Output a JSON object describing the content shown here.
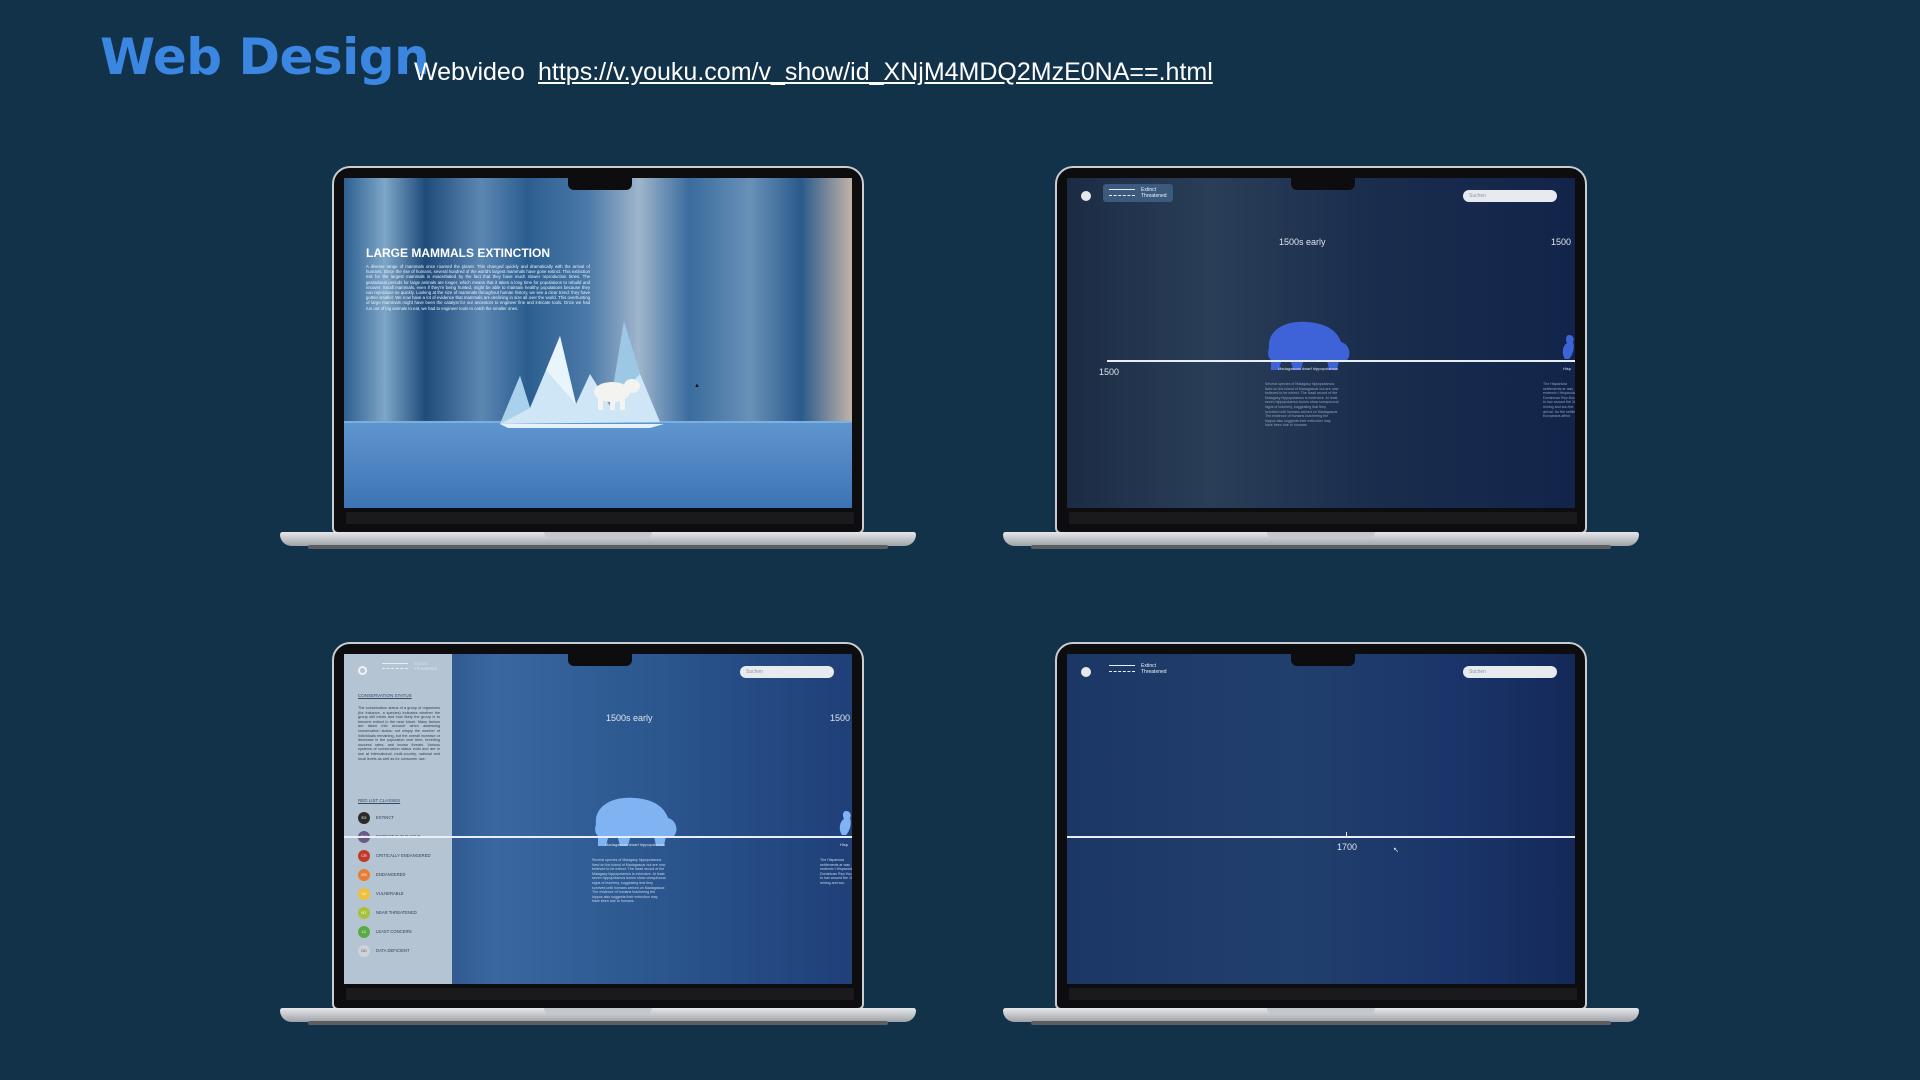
{
  "header": {
    "title": "Web Design",
    "video_label": "Webvideo",
    "video_url": "https://v.youku.com/v_show/id_XNjM4MDQ2MzE0NA==.html"
  },
  "screen1": {
    "heading": "LARGE MAMMALS EXTINCTION",
    "body": "A diverse range of mammals once roamed the planet. This changed quickly and dramatically with the arrival of humans. Since the rise of humans, several hundred of the world's largest mammals have gone extinct. This extinction risk for the largest mammals is exacerbated by the fact that they have much slower reproduction times. The gestational periods for large animals are longer, which means that it takes a long time for populations to rebuild and recover. Small mammals, even if they're being hunted, might be able to maintain healthy populations because they can reproduce so quickly. Looking at the size of mammals throughout human history, we see a clear trend: they have gotten smaller. We now have a lot of evidence that mammals are declining in size all over the world. This overhunting of large mammals might have been the catalyst for our ancestors to engineer fine and intricate tools. Once we had run out of big animals to eat, we had to engineer tools to catch the smaller ones."
  },
  "screen2": {
    "legend": [
      "Extinct",
      "Threatened"
    ],
    "search_placeholder": "Suchen",
    "era_label": "1500s early",
    "era_label_right": "1500",
    "axis_start": "1500",
    "animal_name": "Madagascan dwarf hippopotamus",
    "animal_text": "Several species of Malagasy hippopotamus lived on the island of Madagascar but are now believed to be extinct. The fossil record of the Malagasy hippopotamus is extensive. At least seven hippopotamus bones show unequivocal signs of butchery, suggesting that they survived until humans arrived on Madagascar. The evidence of humans butchering the hippos also suggests their extinction may have been due to humans.",
    "right_partial_name": "Hisp",
    "right_partial_text": "The Hispaniola settlements ar was endemic t Hispaniola. Its Dominican Rep thought to hav around the 16t mining and sou the arrival, fro the settlement Europeans affect"
  },
  "screen3": {
    "legend": [
      "Extinct",
      "Threatened"
    ],
    "search_placeholder": "Suchen",
    "conservation_heading": "CONSERVATION STATUS",
    "conservation_text": "The conservation status of a group of organisms (for instance, a species) indicates whether the group still exists and how likely the group is to become extinct in the near future. Many factors are taken into account when assessing conservation status: not simply the number of individuals remaining, but the overall increase or decrease in the population over time, breeding success rates, and known threats. Various systems of conservation status exist and are in use at international, multi-country, national and local levels as well as for consumer use.",
    "redlist_heading": "RED LIST CLASSES",
    "redlist": [
      {
        "code": "EX",
        "label": "EXTINCT",
        "color": "#2b2b2b"
      },
      {
        "code": "EW",
        "label": "EXTINCT IN THE WILD",
        "color": "#6b5a86"
      },
      {
        "code": "CR",
        "label": "CRITICALLY ENDANGERED",
        "color": "#c0392b"
      },
      {
        "code": "EN",
        "label": "ENDANGERED",
        "color": "#e67e35"
      },
      {
        "code": "VU",
        "label": "VULNERABLE",
        "color": "#f0c03b"
      },
      {
        "code": "NT",
        "label": "NEAR THREATENED",
        "color": "#a8c23a"
      },
      {
        "code": "LC",
        "label": "LEAST CONCERN",
        "color": "#5aaa46"
      },
      {
        "code": "DD",
        "label": "DATA DEFICIENT",
        "color": "#cfd3d8"
      }
    ],
    "era_label": "1500s early",
    "era_label_right": "1500",
    "animal_name": "Madagascan dwarf hippopotamus",
    "animal_text": "Several species of Malagasy hippopotamus lived on the island of Madagascar but are now believed to be extinct. The fossil record of the Malagasy hippopotamus is extensive. At least seven hippopotamus bones show unequivocal signs of butchery, suggesting that they survived until humans arrived on Madagascar. The evidence of humans butchering the hippos also suggests their extinction may have been due to humans.",
    "right_partial_name": "Hisp",
    "right_partial_text": "The Hispaniola settlements ar was endemic t Hispaniola. Its Dominican Rep thought to hav around the 16t mining and sou"
  },
  "screen4": {
    "legend": [
      "Extinct",
      "Threatened"
    ],
    "search_placeholder": "Suchen",
    "axis_label": "1700"
  }
}
